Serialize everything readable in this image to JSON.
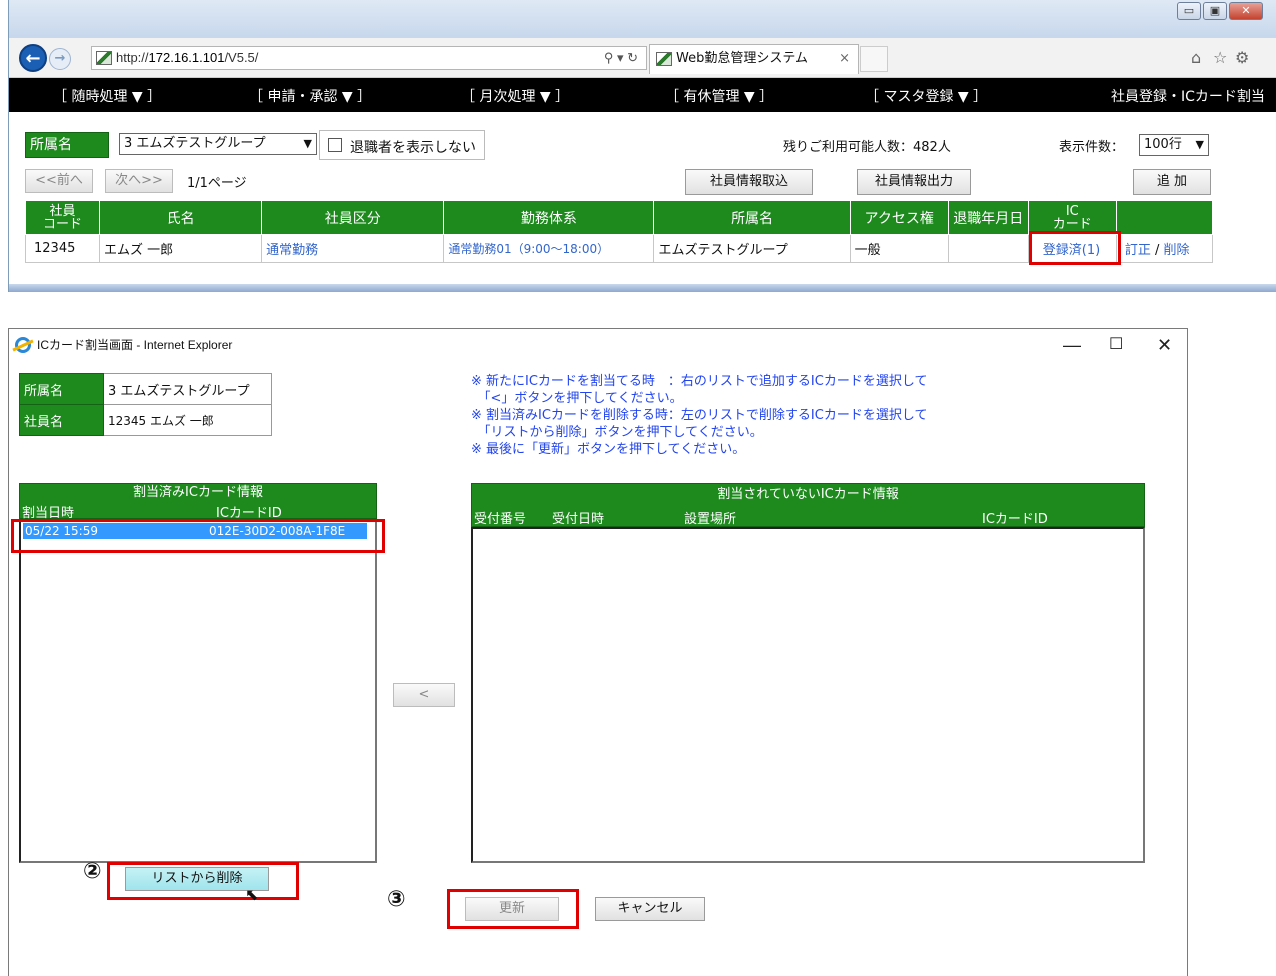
{
  "browser": {
    "url_prefix": "http://",
    "url_host": "172.16.1.101",
    "url_path": "/V5.5/",
    "search_refresh": "⚲ ▾ ↻",
    "tab_title": "Web勤怠管理システム",
    "tab_close": "×",
    "window_controls": [
      "▭",
      "▣",
      "✕"
    ],
    "toolbar_icons": [
      "⌂",
      "☆",
      "⚙"
    ]
  },
  "menu": {
    "items": [
      "［ 随時処理 ▼ ］",
      "［ 申請・承認 ▼ ］",
      "［ 月次処理 ▼ ］",
      "［ 有休管理 ▼ ］",
      "［ マスタ登録 ▼ ］"
    ],
    "page_title": "社員登録・ICカード割当"
  },
  "filter": {
    "dept_label": "所属名",
    "dept_value": "3 エムズテストグループ",
    "hide_retired_label": "退職者を表示しない",
    "remaining_label": "残りご利用可能人数：482人",
    "per_page_label": "表示件数：",
    "per_page_value": "100行"
  },
  "pager": {
    "prev": "<<前へ",
    "next": "次へ>>",
    "page_info": "1/1ページ",
    "import_button": "社員情報取込",
    "export_button": "社員情報出力",
    "add_button": "追 加"
  },
  "employee_table": {
    "headers": [
      "社員\nコード",
      "氏名",
      "社員区分",
      "勤務体系",
      "所属名",
      "アクセス権",
      "退職年月日",
      "IC\nカード",
      ""
    ],
    "rows": [
      {
        "code": "12345",
        "name": "エムズ 一郎",
        "category": "通常勤務",
        "work_system": "通常勤務01（9:00〜18:00）",
        "dept": "エムズテストグループ",
        "access": "一般",
        "retire_date": "",
        "ic_card": "登録済(1)",
        "edit": "訂正",
        "sep": "/",
        "delete": "削除"
      }
    ]
  },
  "dialog": {
    "title": "ICカード割当画面 - Internet Explorer",
    "controls": [
      "—",
      "☐",
      "✕"
    ],
    "dept_label": "所属名",
    "dept_value": "3 エムズテストグループ",
    "emp_label": "社員名",
    "emp_value": "12345 エムズ 一郎",
    "notes": [
      "※ 新たにICカードを割当てる時　：右のリストで追加するICカードを選択して",
      "　「<」ボタンを押下してください。",
      "※ 割当済みICカードを削除する時：左のリストで削除するICカードを選択して",
      "　「リストから削除」ボタンを押下してください。",
      "※ 最後に「更新」ボタンを押下してください。"
    ],
    "assigned_panel": {
      "title": "割当済みICカード情報",
      "col_date": "割当日時",
      "col_id": "ICカードID",
      "items": [
        {
          "date": "05/22 15:59",
          "id": "012E-30D2-008A-1F8E"
        }
      ]
    },
    "unassigned_panel": {
      "title": "割当されていないICカード情報",
      "col_no": "受付番号",
      "col_date": "受付日時",
      "col_place": "設置場所",
      "col_id": "ICカードID"
    },
    "move_button": "<",
    "remove_button": "リストから削除",
    "update_button": "更新",
    "cancel_button": "キャンセル",
    "step2": "②",
    "step3": "③"
  },
  "colors": {
    "header_green": "#1e8a1e",
    "highlight_red": "#e00000",
    "link_blue": "#3366cc",
    "note_blue": "#2244ee"
  }
}
